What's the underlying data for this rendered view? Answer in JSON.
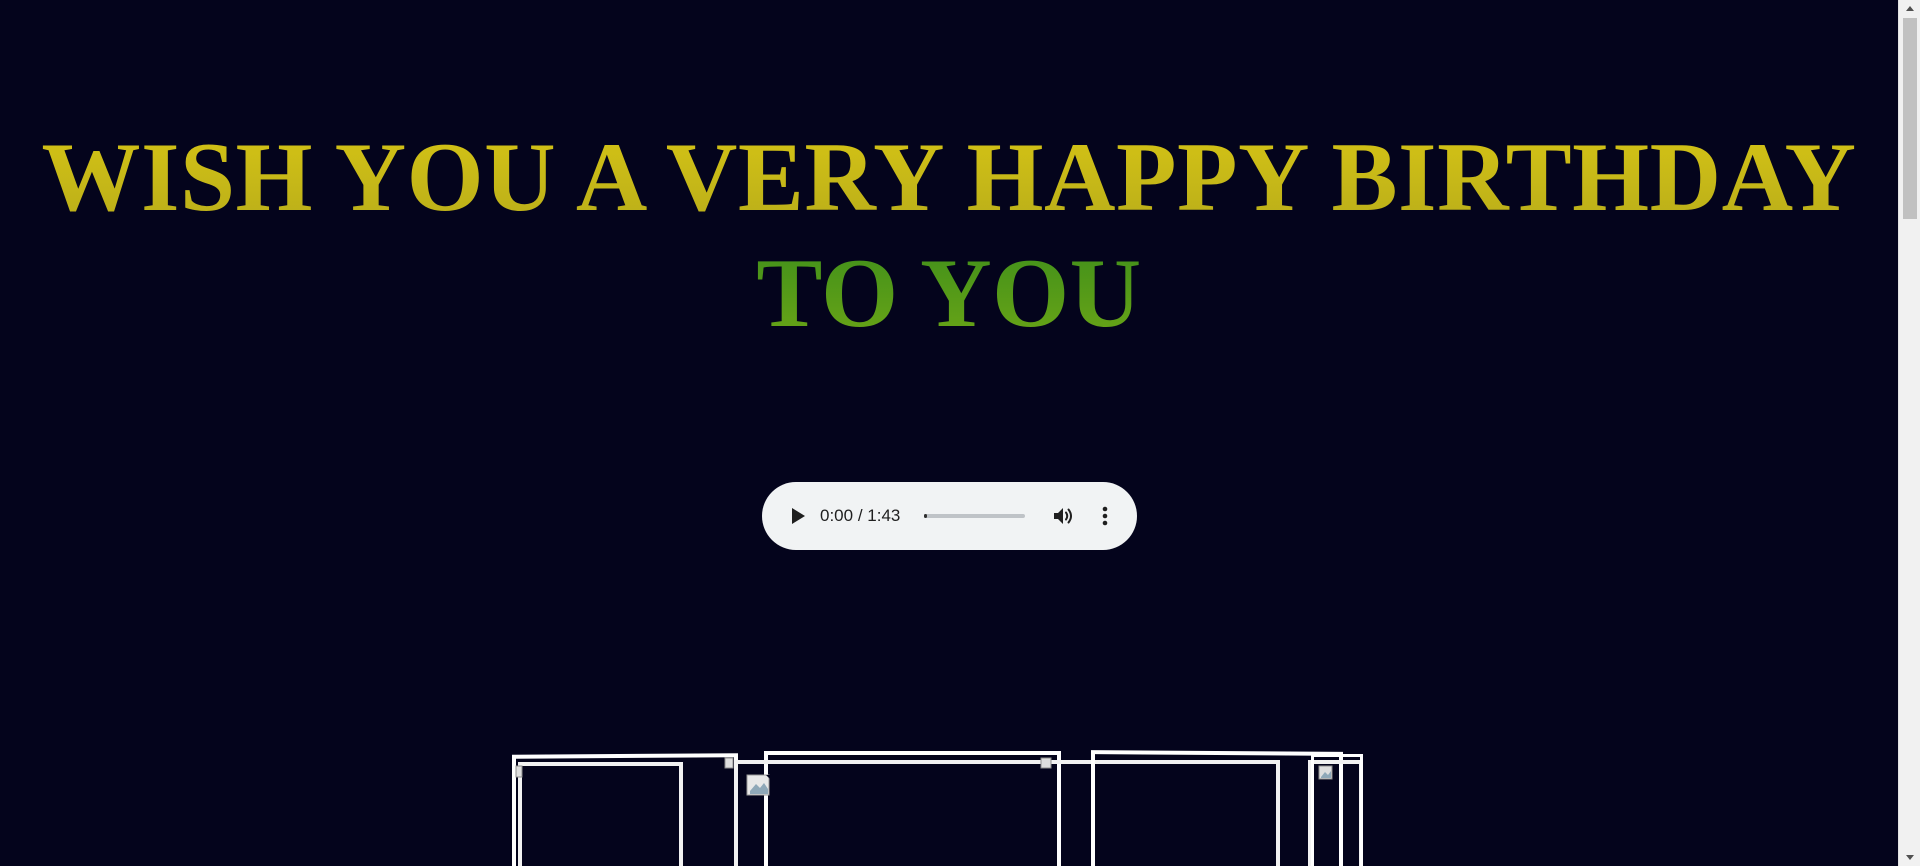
{
  "heading": {
    "line1": "WISH YOU A VERY HAPPY BIRTHDAY",
    "line2": "TO YOU"
  },
  "audio_player": {
    "current_time": "0:00",
    "separator": "/",
    "duration": "1:43",
    "progress_fraction": 0.0,
    "icons": {
      "play": "play-icon",
      "volume": "volume-icon",
      "more": "more-vertical-icon"
    }
  },
  "gallery": {
    "frame_count": 4,
    "icons": {
      "broken_image": "broken-image-icon"
    }
  },
  "colors": {
    "background": "#04041c",
    "heading_line1": "#c4b615",
    "heading_line2": "#4f9a1b",
    "player_background": "#f1f3f4",
    "frame_border": "#ffffff"
  }
}
